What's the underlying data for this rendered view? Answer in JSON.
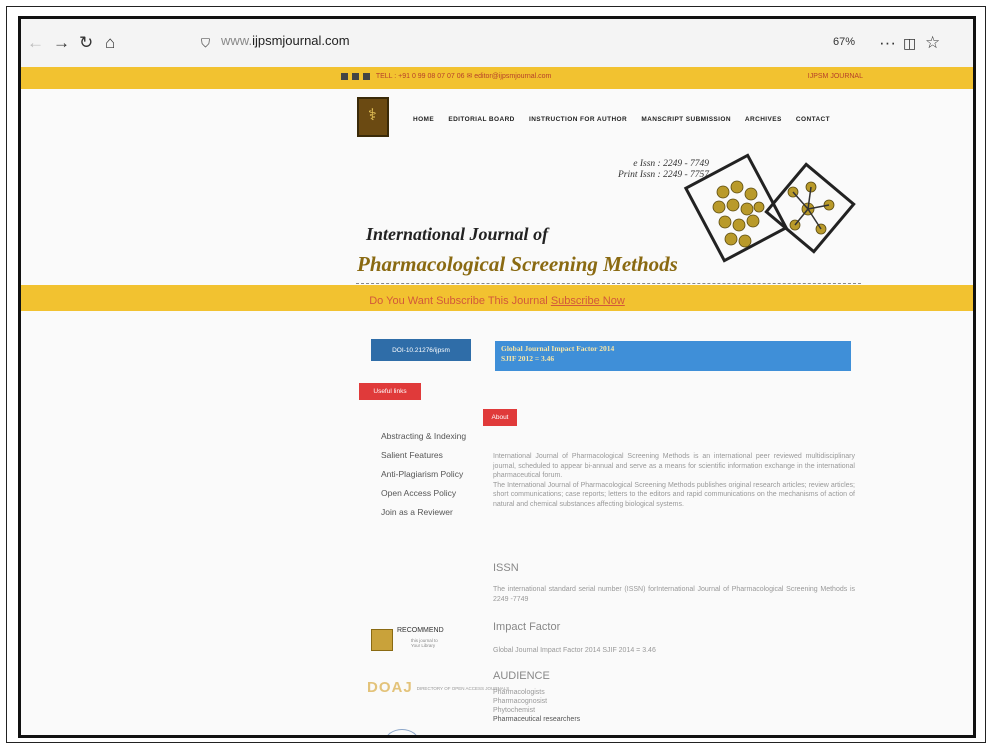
{
  "browser": {
    "url_prefix": "www.",
    "url_domain": "ijpsmjournal.com",
    "zoom": "67%"
  },
  "topbar": {
    "contact": "TELL : +91 0 99 08 07 07 06   ✉ editor@ijpsmjournal.com",
    "brand": "IJPSM JOURNAL"
  },
  "nav": [
    "HOME",
    "EDITORIAL BOARD",
    "INSTRUCTION FOR AUTHOR",
    "MANSCRIPT SUBMISSION",
    "ARCHIVES",
    "CONTACT"
  ],
  "header": {
    "eissn": "e Issn : 2249 - 7749",
    "print_issn": "Print Issn : 2249 - 7757",
    "title_line1": "International Journal of",
    "title_line2": "Pharmacological Screening Methods"
  },
  "subscribe": {
    "text": "Do You Want Subscribe This Journal",
    "link": "Subscribe Now"
  },
  "sidebar": {
    "doi_label": "DOI-10.21276/ijpsm",
    "useful_links": "Useful links",
    "items": [
      "Abstracting & Indexing",
      "Salient Features",
      "Anti-Plagiarism Policy",
      "Open Access Policy",
      "Join as a Reviewer"
    ],
    "recommend_title": "RECOMMEND",
    "recommend_sub1": "this journal to",
    "recommend_sub2": "Your Library",
    "doaj": "DOAJ",
    "doaj_sub": "DIRECTORY OF OPEN ACCESS JOURNALS"
  },
  "main": {
    "impact_line1": "Global Journal Impact Factor 2014",
    "impact_line2": "SJIF 2012 = 3.46",
    "about_label": "About",
    "about_p1": "International Journal of Pharmacological Screening Methods is an international peer reviewed multidisciplinary journal, scheduled to appear bi-annual and serve as a means for scientific information exchange in the international pharmaceutical forum.",
    "about_p2": "The International Journal of Pharmacological Screening Methods publishes original research articles; review articles; short communications; case reports; letters to the editors and rapid communications on the mechanisms of action of natural and chemical substances affecting biological systems.",
    "issn_heading": "ISSN",
    "issn_text": "The international standard serial number (ISSN) forInternational Journal of Pharmacological Screening Methods is 2249 -7749",
    "impact_heading": "Impact Factor",
    "impact_text": "Global Journal Impact Factor 2014 SJIF 2014 = 3.46",
    "audience_heading": "AUDIENCE",
    "audience": [
      "Pharmacologists",
      "Pharmacognosist",
      "Phytochemist",
      "Pharmaceutical researchers"
    ]
  },
  "colors": {
    "yellow": "#f2c230",
    "blue": "#3f8fd8",
    "red": "#e03a3a",
    "gold": "#8a6a12"
  }
}
